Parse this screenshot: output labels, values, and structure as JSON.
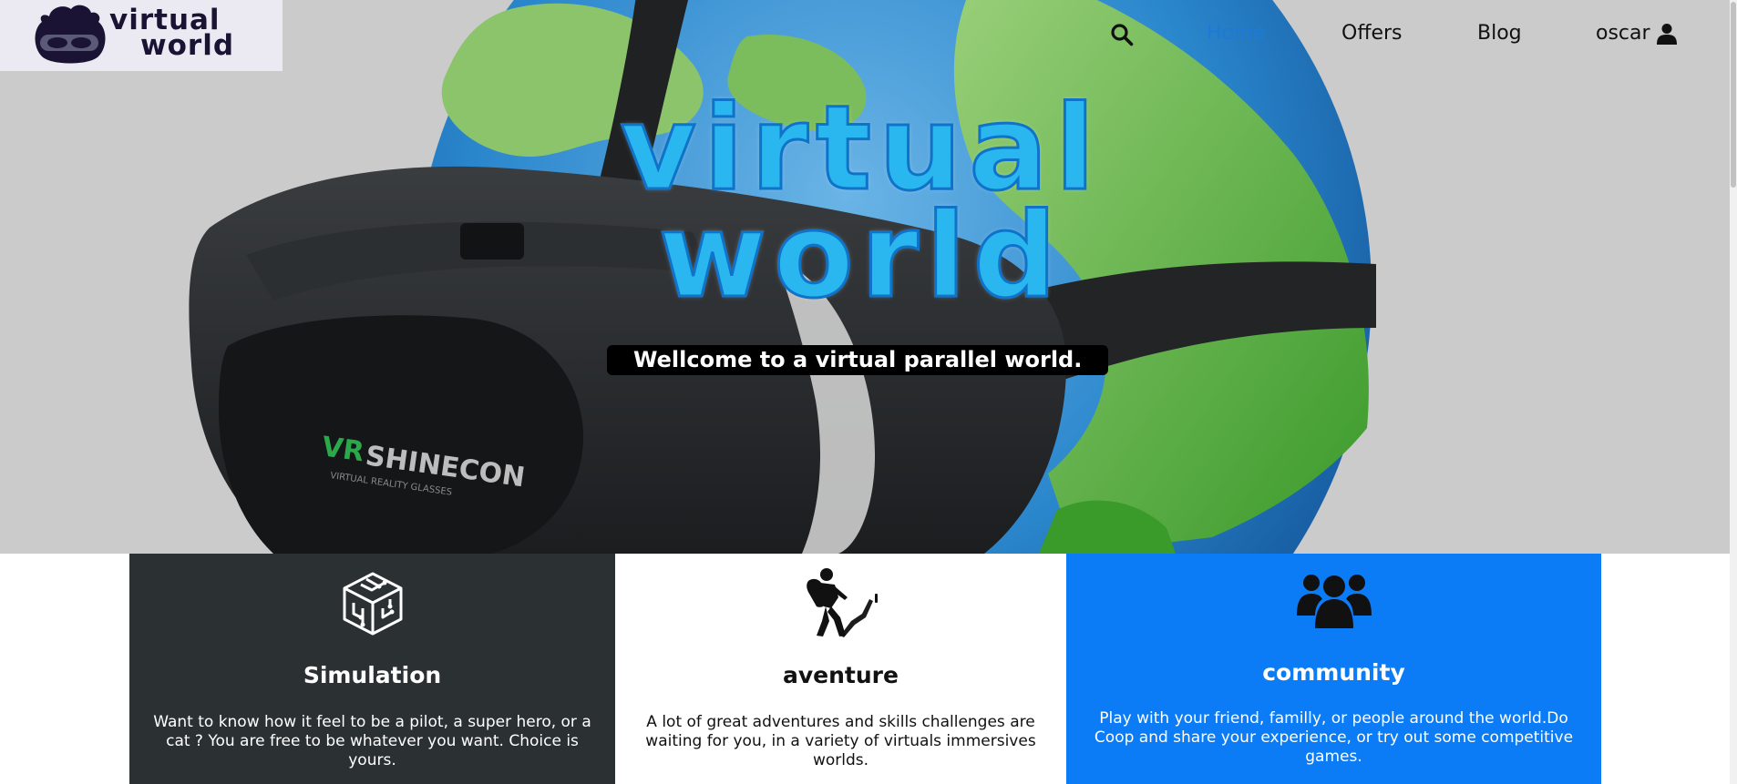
{
  "brand": {
    "logo_line1": "virtual",
    "logo_line2": "world"
  },
  "nav": {
    "search_icon": "search-icon",
    "items": [
      {
        "label": "Home",
        "active": true
      },
      {
        "label": "Offers",
        "active": false
      },
      {
        "label": "Blog",
        "active": false
      }
    ],
    "user_label": "oscar",
    "user_icon": "user-icon"
  },
  "hero": {
    "title_line1": "virtual",
    "title_line2": "world",
    "tagline": "Wellcome to a virtual parallel world.",
    "headset_brand": "VR SHINECON",
    "headset_sub": "VIRTUAL REALITY GLASSES"
  },
  "features": [
    {
      "icon": "circuit-cube-icon",
      "title": "Simulation",
      "description": "Want to know how it feel to be a pilot, a super hero, or a cat ? You are free to be whatever you want. Choice is yours."
    },
    {
      "icon": "hiker-icon",
      "title": "aventure",
      "description": "A lot of great adventures and skills challenges are waiting for you, in a variety of virtuals immersives worlds."
    },
    {
      "icon": "users-icon",
      "title": "community",
      "description": "Play with your friend, familly, or people around the world.Do Coop and share your experience, or try out some competitive games."
    }
  ],
  "colors": {
    "nav_active": "#1e7ad6",
    "card_simulation_bg": "#2b3133",
    "card_community_bg": "#0b7cf5",
    "title_blue": "#2ab6ef"
  }
}
